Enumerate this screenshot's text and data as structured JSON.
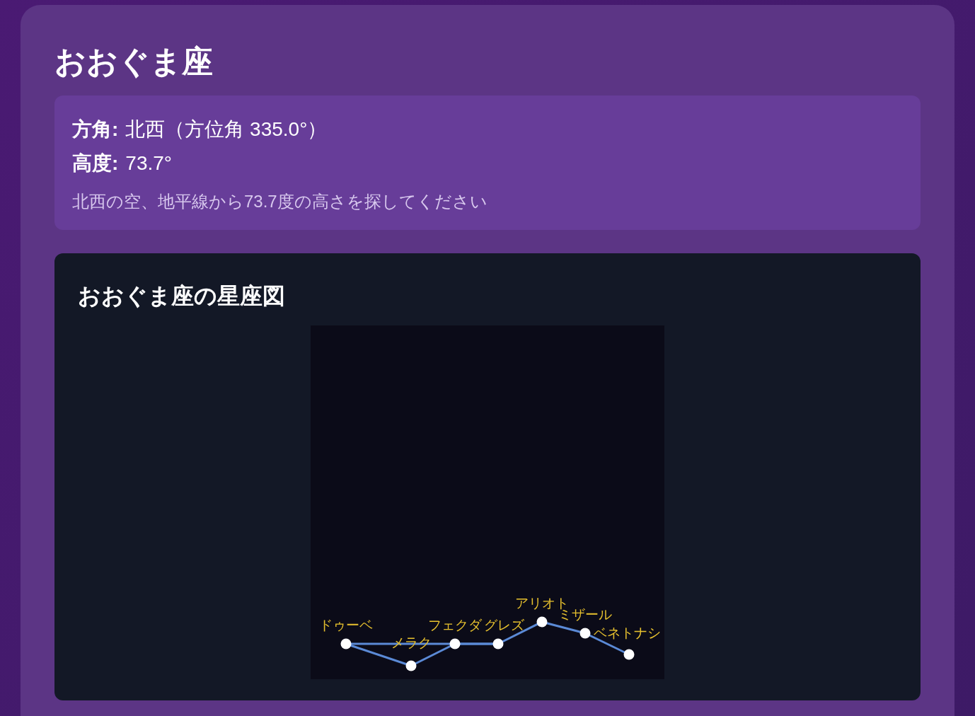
{
  "title": "おおぐま座",
  "info": {
    "direction_label": "方角:",
    "direction": "北西（方位角 335.0°）",
    "altitude_label": "高度:",
    "altitude": "73.7°",
    "hint": "北西の空、地平線から73.7度の高さを探してください"
  },
  "map": {
    "title": "おおぐま座の星座図",
    "stars": [
      {
        "label": "ドゥーベ"
      },
      {
        "label": "メラク"
      },
      {
        "label": "フェクダ"
      },
      {
        "label": "グレズ"
      },
      {
        "label": "アリオト"
      },
      {
        "label": "ミザール"
      },
      {
        "label": "ベネトナシ"
      }
    ]
  }
}
